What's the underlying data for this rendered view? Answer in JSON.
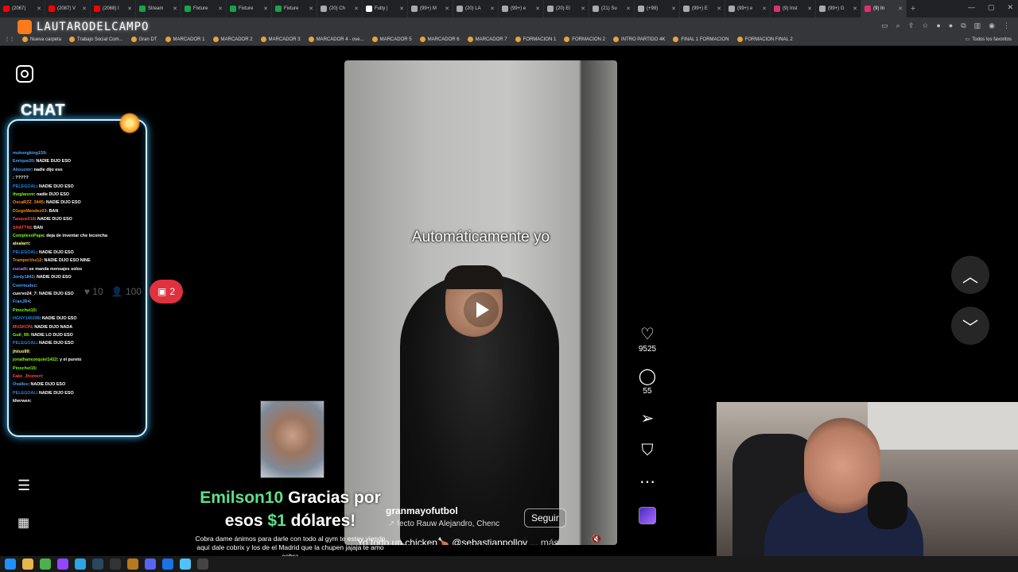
{
  "browser": {
    "tabs": [
      {
        "label": "(2067)",
        "color": "#ff0000"
      },
      {
        "label": "(2087) V",
        "color": "#ff0000"
      },
      {
        "label": "(2068) I",
        "color": "#ff0000"
      },
      {
        "label": "Stream",
        "color": "#16a34a"
      },
      {
        "label": "Fixture",
        "color": "#16a34a"
      },
      {
        "label": "Fixture",
        "color": "#16a34a"
      },
      {
        "label": "Fixture",
        "color": "#16a34a"
      },
      {
        "label": "(20) Ch",
        "color": "#aaaaaa"
      },
      {
        "label": "Futty |",
        "color": "#ffffff"
      },
      {
        "label": "(99+) M",
        "color": "#aaaaaa"
      },
      {
        "label": "(20) LA",
        "color": "#aaaaaa"
      },
      {
        "label": "(99+) e",
        "color": "#aaaaaa"
      },
      {
        "label": "(20) El",
        "color": "#aaaaaa"
      },
      {
        "label": "(21) Su",
        "color": "#aaaaaa"
      },
      {
        "label": "(+99)",
        "color": "#aaaaaa"
      },
      {
        "label": "(99+) E",
        "color": "#aaaaaa"
      },
      {
        "label": "(99+) e",
        "color": "#aaaaaa"
      },
      {
        "label": "(9) Inst",
        "color": "#e1306c"
      },
      {
        "label": "(99+) G",
        "color": "#aaaaaa"
      },
      {
        "label": "(9) In",
        "color": "#e1306c",
        "active": true
      }
    ],
    "new_tab": "+",
    "bookmarks": [
      "Nueva carpeta",
      "Trabajo Social Com...",
      "Gran DT",
      "MARCADOR 1",
      "MARCADOR 2",
      "MARCADOR 3",
      "MARCADOR 4 - ove...",
      "MARCADOR 5",
      "MARCADOR 6",
      "MARCADOR 7",
      "FORMACION 1",
      "FORMACION 2",
      "INTRO PARTIDO 4K",
      "FINAL 1 FORMACION",
      "FORMACION FINAL 2"
    ],
    "all_bookmarks": "Todos los favoritos"
  },
  "stream_logo": "LAUTARODELCAMPO",
  "chat": {
    "title": "CHAT",
    "lines": [
      {
        "user": "mukongking159",
        "text": ": ",
        "color": "#4aa3ff"
      },
      {
        "user": "Enrique20",
        "text": ": NADIE DIJO ESO",
        "color": "#4aa3ff"
      },
      {
        "user": "Abouzmr",
        "text": ": nadie dijo eso",
        "color": "#4aa3ff"
      },
      {
        "user": "",
        "text": ": ?????",
        "color": "#ff4444"
      },
      {
        "user": "PELEGOAL",
        "text": ": NADIE DIJO ESO",
        "color": "#1e88e5"
      },
      {
        "user": "theglanzm",
        "text": ": nadie DIJO ESO",
        "color": "#7cfc00"
      },
      {
        "user": "OscaRZZ_3445",
        "text": ": NADIE DIJO ESO",
        "color": "#ff8c00"
      },
      {
        "user": "D1egoMendez03",
        "text": ": BAN",
        "color": "#ff8c00"
      },
      {
        "user": "Tanque018",
        "text": ": NADIE DIJO ESO",
        "color": "#ff4444"
      },
      {
        "user": "SHATTNI",
        "text": ": BAN",
        "color": "#ff4444"
      },
      {
        "user": "ComplesoPapa",
        "text": ": deja de inventar che leconcha",
        "color": "#7cfc00"
      },
      {
        "user": "alealarri",
        "text": ": ",
        "color": "#ffff66"
      },
      {
        "user": "PELEGOAL",
        "text": ": NADIE DIJO ESO",
        "color": "#1e88e5"
      },
      {
        "user": "TramperVez12",
        "text": ": NADIE DIJO ESO NINE",
        "color": "#ff8c00"
      },
      {
        "user": "cucadt",
        "text": ": se manda mensajes solos",
        "color": "#c084fc"
      },
      {
        "user": "Jordy1842",
        "text": ": NADIE DIJO ESO",
        "color": "#4aa3ff"
      },
      {
        "user": "Cvermudez",
        "text": ": ",
        "color": "#4aa3ff"
      },
      {
        "user": "cuervo24_7",
        "text": ": NADIE DIJO ESO",
        "color": "#ffffff"
      },
      {
        "user": "FranJR4",
        "text": ": ",
        "color": "#4aa3ff"
      },
      {
        "user": "Pinochet15",
        "text": ": ",
        "color": "#7cfc00"
      },
      {
        "user": "HGNY140298",
        "text": ": NADIE DIJO ESO",
        "color": "#1e88e5"
      },
      {
        "user": "MUSKON",
        "text": ": NADIE DIJO NADA",
        "color": "#ff4444"
      },
      {
        "user": "Guti_99",
        "text": ": NADIE LO DIJO ESO",
        "color": "#7cfc00"
      },
      {
        "user": "PELEGOAL",
        "text": ": NADIE DIJO ESO",
        "color": "#1e88e5"
      },
      {
        "user": "jhiiuo99",
        "text": ": ",
        "color": "#ffff66"
      },
      {
        "user": "jonathanezequiel1422",
        "text": ": y el pureto",
        "color": "#7cfc00"
      },
      {
        "user": "Pinochet15",
        "text": ": ",
        "color": "#7cfc00"
      },
      {
        "user": "Fake_Jhomeri",
        "text": ": ",
        "color": "#ff4444"
      },
      {
        "user": "Ovalles",
        "text": ": NADIE DIJO ESO",
        "color": "#4aa3ff"
      },
      {
        "user": "PELEGOAL",
        "text": ": NADIE DIJO ESO",
        "color": "#1e88e5"
      },
      {
        "user": "kherwen",
        "text": ": ",
        "color": "#ffffff"
      }
    ],
    "likes": "10",
    "viewers": "100",
    "badge_count": "2"
  },
  "video": {
    "caption": "Automáticamente yo",
    "username": "granmayofutbol",
    "music": "fecto   Rauw Alejandro, Chenc",
    "description": "Yo todo un chicken🍗 @sebastianpollov",
    "more": "... más",
    "follow": "Seguir"
  },
  "actions": {
    "likes": "9525",
    "comments": "55"
  },
  "donation": {
    "name": "Emilson10",
    "thanks": "Gracias por",
    "those": "esos",
    "amount": "$1",
    "currency": "dólares!",
    "message": "Cobra dame ánimos para darle con todo al gym te estoy viendo aquí dale cobrix y los de el Madrid que la chupen jajaja te amo cobra"
  }
}
